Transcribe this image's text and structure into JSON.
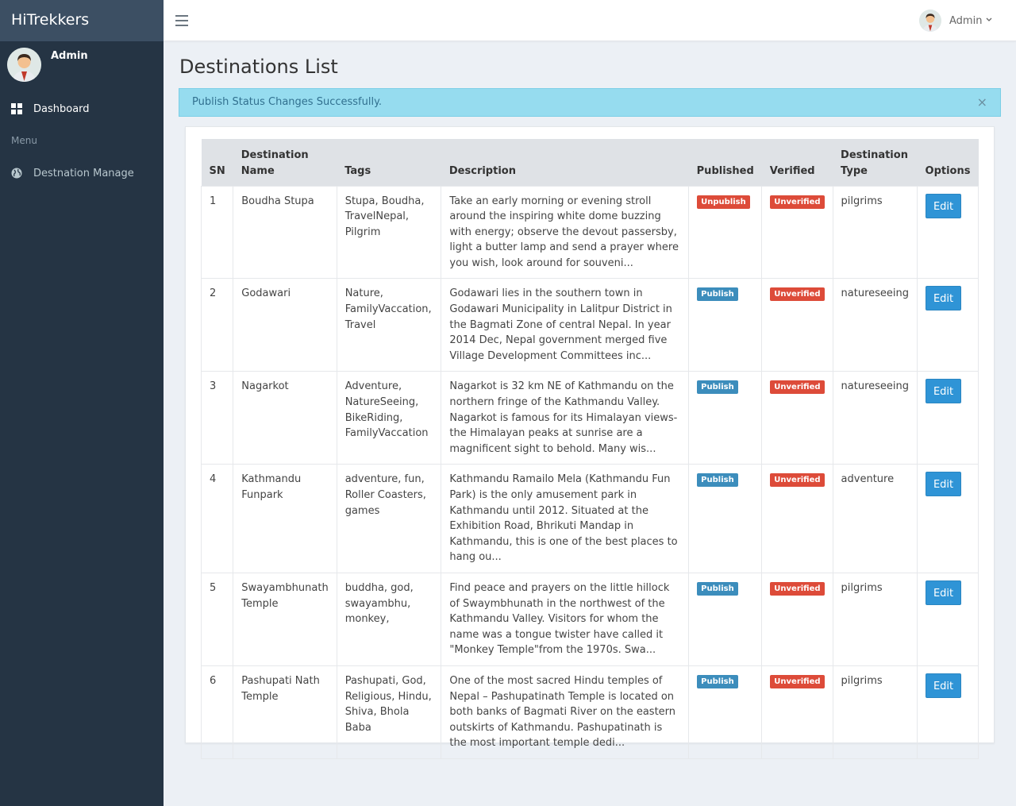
{
  "brand": "HiTrekkers",
  "user": {
    "name": "Admin"
  },
  "sidebar": {
    "dashboard_label": "Dashboard",
    "menu_header": "Menu",
    "destination_label": "Destnation Manage"
  },
  "topbar": {
    "user_name": "Admin"
  },
  "page_title": "Destinations List",
  "alert": {
    "message": "Publish Status Changes Successfully.",
    "close": "×"
  },
  "table": {
    "headers": {
      "sn": "SN",
      "name_line1": "Destination",
      "name_line2": "Name",
      "tags": "Tags",
      "description": "Description",
      "published": "Published",
      "verified": "Verified",
      "type_line1": "Destination",
      "type_line2": "Type",
      "options": "Options"
    },
    "rows": [
      {
        "sn": "1",
        "name": "Boudha Stupa",
        "tags": "Stupa, Boudha, TravelNepal, Pilgrim",
        "description": "Take an early morning or evening stroll around the inspiring white dome buzzing with energy; observe the devout passersby, light a butter lamp and send a prayer where you wish, look around for souveni...",
        "published": "Unpublish",
        "verified": "Unverified",
        "type": "pilgrims",
        "action": "Edit"
      },
      {
        "sn": "2",
        "name": "Godawari",
        "tags": "Nature, FamilyVaccation, Travel",
        "description": "Godawari lies in the southern town in Godawari Municipality in Lalitpur District in the Bagmati Zone of central Nepal. In year 2014 Dec, Nepal government merged five Village Development Committees inc...",
        "published": "Publish",
        "verified": "Unverified",
        "type": "natureseeing",
        "action": "Edit"
      },
      {
        "sn": "3",
        "name": "Nagarkot",
        "tags": "Adventure, NatureSeeing, BikeRiding, FamilyVaccation",
        "description": "Nagarkot is 32 km NE of Kathmandu on the northern fringe of the Kathmandu Valley. Nagarkot is famous for its Himalayan views- the Himalayan peaks at sunrise are a magnificent sight to behold. Many wis...",
        "published": "Publish",
        "verified": "Unverified",
        "type": "natureseeing",
        "action": "Edit"
      },
      {
        "sn": "4",
        "name": "Kathmandu Funpark",
        "tags": "adventure, fun, Roller Coasters, games",
        "description": "Kathmandu Ramailo Mela (Kathmandu Fun Park) is the only amusement park in Kathmandu until 2012. Situated at the Exhibition Road, Bhrikuti Mandap in Kathmandu, this is one of the best places to hang ou...",
        "published": "Publish",
        "verified": "Unverified",
        "type": "adventure",
        "action": "Edit"
      },
      {
        "sn": "5",
        "name": "Swayambhunath Temple",
        "tags": "buddha, god, swayambhu, monkey,",
        "description": "Find peace and prayers on the little hillock of Swaymbhunath in the northwest of the Kathmandu Valley. Visitors for whom the name was a tongue twister have called it \"Monkey Temple\"from the 1970s. Swa...",
        "published": "Publish",
        "verified": "Unverified",
        "type": "pilgrims",
        "action": "Edit"
      },
      {
        "sn": "6",
        "name": "Pashupati Nath Temple",
        "tags": "Pashupati, God, Religious, Hindu, Shiva, Bhola Baba",
        "description": "One of the most sacred Hindu temples of Nepal – Pashupatinath Temple is located on both banks of Bagmati River on the eastern outskirts of Kathmandu. Pashupatinath is the most important temple dedi...",
        "published": "Publish",
        "verified": "Unverified",
        "type": "pilgrims",
        "action": "Edit"
      }
    ]
  },
  "colors": {
    "sidebar": "#253444",
    "brand_bar": "#3c4f63",
    "alert_bg": "#96dcef",
    "badge_red": "#dd4b39",
    "badge_blue": "#3c8dbc",
    "edit_button": "#2f94d6"
  }
}
